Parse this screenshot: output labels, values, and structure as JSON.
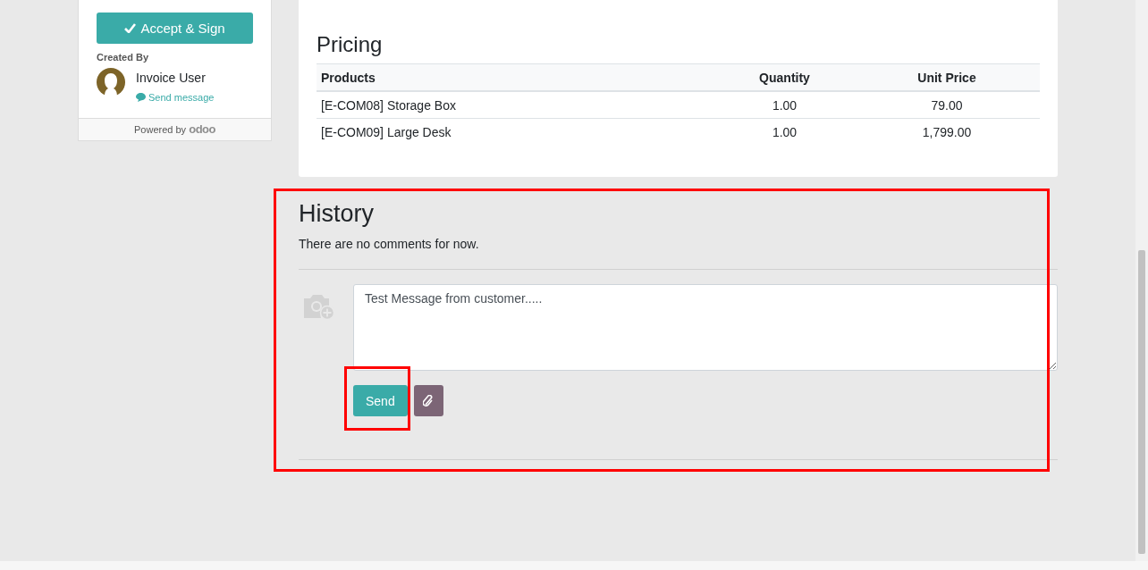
{
  "sidebar": {
    "accept_button": "Accept & Sign",
    "created_by_label": "Created By",
    "user_name": "Invoice User",
    "send_message_link": "Send message",
    "powered_by": "Powered by",
    "brand": "odoo"
  },
  "pricing": {
    "title": "Pricing",
    "table": {
      "columns": [
        "Products",
        "Quantity",
        "Unit Price"
      ],
      "rows": [
        {
          "product": "[E-COM08] Storage Box",
          "quantity": "1.00",
          "unit_price": "79.00"
        },
        {
          "product": "[E-COM09] Large Desk",
          "quantity": "1.00",
          "unit_price": "1,799.00"
        }
      ]
    }
  },
  "history": {
    "title": "History",
    "empty_text": "There are no comments for now.",
    "message": {
      "value": "Test Message from customer....."
    },
    "send_button": "Send"
  }
}
